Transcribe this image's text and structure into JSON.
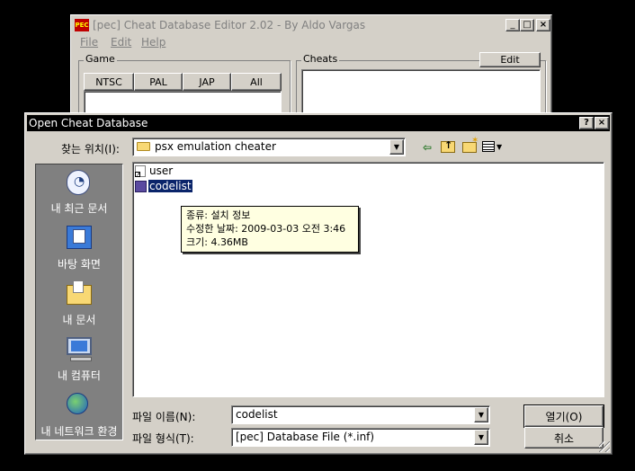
{
  "bg_window": {
    "title": "[pec] Cheat Database Editor 2.02 - By Aldo Vargas",
    "menu": [
      "File",
      "Edit",
      "Help"
    ],
    "game_group_label": "Game",
    "region_tabs": [
      "NTSC",
      "PAL",
      "JAP",
      "All"
    ],
    "cheats_group_label": "Cheats",
    "edit_button": "Edit"
  },
  "dialog": {
    "title": "Open Cheat Database",
    "help_btn": "?",
    "close_btn": "×",
    "lookin_label": "찾는 위치(I):",
    "lookin_value": "psx emulation cheater",
    "places": [
      {
        "label": "내 최근 문서",
        "icon": "recent-documents-icon"
      },
      {
        "label": "바탕 화면",
        "icon": "desktop-icon"
      },
      {
        "label": "내 문서",
        "icon": "my-documents-icon"
      },
      {
        "label": "내 컴퓨터",
        "icon": "my-computer-icon"
      },
      {
        "label": "내 네트워크 환경",
        "icon": "network-places-icon"
      }
    ],
    "files": [
      {
        "name": "user",
        "icon": "shortcut-file-icon"
      },
      {
        "name": "codelist",
        "icon": "setup-info-file-icon"
      }
    ],
    "tooltip": {
      "line1": "종류: 설치 정보",
      "line2": "수정한 날짜: 2009-03-03 오전 3:46",
      "line3": "크기: 4.36MB"
    },
    "filename_label": "파일 이름(N):",
    "filename_value": "codelist",
    "filetype_label": "파일 형식(T):",
    "filetype_value": "[pec] Database File (*.inf)",
    "open_btn": "열기(O)",
    "cancel_btn": "취소"
  },
  "colors": {
    "title_active": "#000000",
    "title_inactive": "#808080",
    "face": "#d4d0c8",
    "selection": "#0a246a",
    "tooltip_bg": "#ffffe1",
    "places_bar": "#808080"
  }
}
